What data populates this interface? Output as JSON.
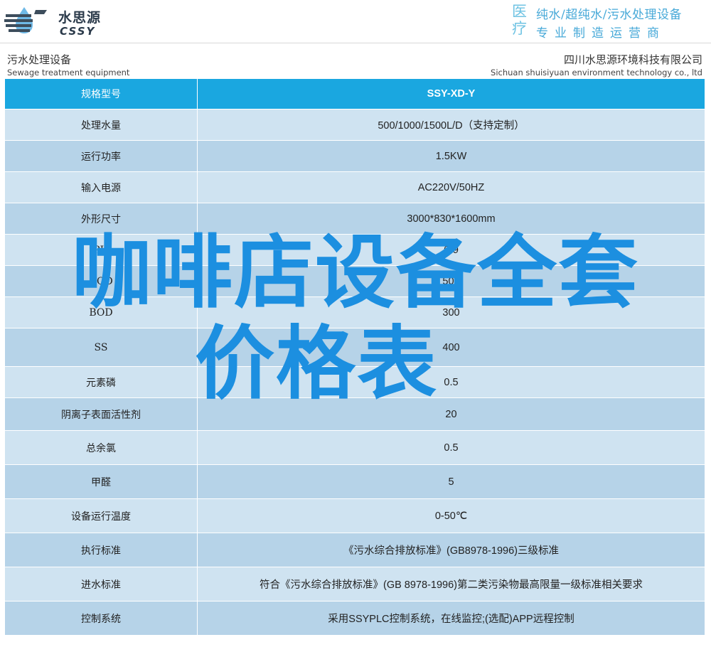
{
  "header": {
    "logo_cn": "水思源",
    "logo_en": "CSSY",
    "slogan_big": "医疗",
    "slogan_line1": "纯水/超纯水/污水处理设备",
    "slogan_line2": "专业制造运营商"
  },
  "subheader": {
    "left_cn": "污水处理设备",
    "left_en": "Sewage treatment equipment",
    "right_cn": "四川水思源环境科技有限公司",
    "right_en": "Sichuan shuisiyuan environment technology co., ltd"
  },
  "table": {
    "rows": [
      {
        "label": "规格型号",
        "value": "SSY-XD-Y"
      },
      {
        "label": "处理水量",
        "value": "500/1000/1500L/D（支持定制）"
      },
      {
        "label": "运行功率",
        "value": "1.5KW"
      },
      {
        "label": "输入电源",
        "value": "AC220V/50HZ"
      },
      {
        "label": "外形尺寸",
        "value": "3000*830*1600mm"
      },
      {
        "label": "PH",
        "value": "6-9"
      },
      {
        "label": "COD",
        "value": "500"
      },
      {
        "label": "BOD",
        "value": "300"
      },
      {
        "label": "SS",
        "value": "400"
      },
      {
        "label": "元素磷",
        "value": "0.5"
      },
      {
        "label": "阴离子表面活性剂",
        "value": "20"
      },
      {
        "label": "总余氯",
        "value": "0.5"
      },
      {
        "label": "甲醛",
        "value": "5"
      },
      {
        "label": "设备运行温度",
        "value": "0-50℃"
      },
      {
        "label": "执行标准",
        "value": "《污水综合排放标准》(GB8978-1996)三级标准"
      },
      {
        "label": "进水标准",
        "value": "符合《污水综合排放标准》(GB 8978-1996)第二类污染物最高限量一级标准相关要求"
      },
      {
        "label": "控制系统",
        "value": "采用SSYPLC控制系统，在线监控;(选配)APP远程控制"
      }
    ]
  },
  "overlay": {
    "line1": "咖啡店设备全套",
    "line2": "价格表",
    "color": "#1c8fe0"
  }
}
